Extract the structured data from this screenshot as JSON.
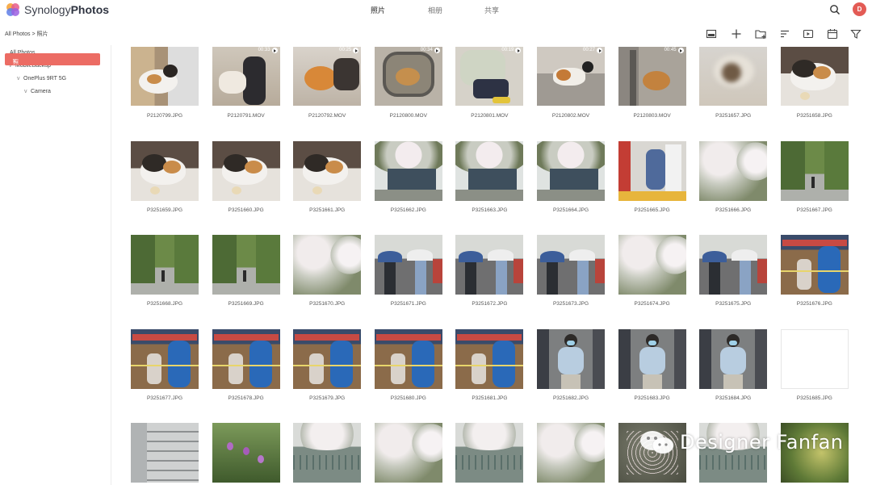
{
  "app": {
    "brand_prefix": "Synology",
    "brand_name": "Photos",
    "avatar_letter": "D",
    "accent_color": "#ec6c64"
  },
  "nav_tabs": [
    {
      "label": "照片",
      "active": true
    },
    {
      "label": "相册",
      "active": false
    },
    {
      "label": "共享",
      "active": false
    }
  ],
  "breadcrumb": {
    "root": "All Photos",
    "separator": ">",
    "current": "照片"
  },
  "toolbar": {
    "icons": [
      "select-icon",
      "add-icon",
      "new-folder-icon",
      "sort-icon",
      "slideshow-icon",
      "calendar-icon",
      "filter-icon"
    ]
  },
  "sidebar": {
    "items": [
      {
        "label": "All Photos",
        "depth": 0,
        "chevron": ""
      },
      {
        "label": "MobileBackup",
        "depth": 1,
        "chevron": "v"
      },
      {
        "label": "OnePlus 9RT 5G",
        "depth": 2,
        "chevron": "v"
      },
      {
        "label": "Camera",
        "depth": 3,
        "chevron": "v"
      },
      {
        "label": "照片",
        "depth": 1,
        "chevron": "v",
        "active": true
      }
    ]
  },
  "photos": [
    {
      "name": "P2120799.JPG",
      "scene": "cat-indoor"
    },
    {
      "name": "P2120791.MOV",
      "scene": "person-sofa",
      "duration": "00:33"
    },
    {
      "name": "P2120792.MOV",
      "scene": "cat-orange",
      "duration": "00:25"
    },
    {
      "name": "P2120800.MOV",
      "scene": "cat-carrier",
      "duration": "00:34"
    },
    {
      "name": "P2120801.MOV",
      "scene": "person-sit",
      "duration": "00:19"
    },
    {
      "name": "P2120802.MOV",
      "scene": "cat-walk",
      "duration": "00:27"
    },
    {
      "name": "P2120803.MOV",
      "scene": "cat-pole",
      "duration": "00:45"
    },
    {
      "name": "P3251657.JPG",
      "scene": "blur"
    },
    {
      "name": "P3251658.JPG",
      "scene": "cat-sit"
    },
    {
      "name": "P3251659.JPG",
      "scene": "cat-sit"
    },
    {
      "name": "P3251660.JPG",
      "scene": "cat-sit"
    },
    {
      "name": "P3251661.JPG",
      "scene": "cat-sit"
    },
    {
      "name": "P3251662.JPG",
      "scene": "blossom-house"
    },
    {
      "name": "P3251663.JPG",
      "scene": "blossom-house"
    },
    {
      "name": "P3251664.JPG",
      "scene": "blossom-house"
    },
    {
      "name": "P3251665.JPG",
      "scene": "person-blue"
    },
    {
      "name": "P3251666.JPG",
      "scene": "blossom"
    },
    {
      "name": "P3251667.JPG",
      "scene": "park"
    },
    {
      "name": "P3251668.JPG",
      "scene": "park"
    },
    {
      "name": "P3251669.JPG",
      "scene": "park"
    },
    {
      "name": "P3251670.JPG",
      "scene": "blossom"
    },
    {
      "name": "P3251671.JPG",
      "scene": "umbrella"
    },
    {
      "name": "P3251672.JPG",
      "scene": "umbrella"
    },
    {
      "name": "P3251673.JPG",
      "scene": "umbrella"
    },
    {
      "name": "P3251674.JPG",
      "scene": "blossom"
    },
    {
      "name": "P3251675.JPG",
      "scene": "umbrella"
    },
    {
      "name": "P3251676.JPG",
      "scene": "workers"
    },
    {
      "name": "P3251677.JPG",
      "scene": "workers"
    },
    {
      "name": "P3251678.JPG",
      "scene": "workers"
    },
    {
      "name": "P3251679.JPG",
      "scene": "workers"
    },
    {
      "name": "P3251680.JPG",
      "scene": "workers"
    },
    {
      "name": "P3251681.JPG",
      "scene": "workers"
    },
    {
      "name": "P3251682.JPG",
      "scene": "woman-mask"
    },
    {
      "name": "P3251683.JPG",
      "scene": "woman-mask"
    },
    {
      "name": "P3251684.JPG",
      "scene": "woman-mask"
    },
    {
      "name": "P3251685.JPG",
      "scene": "empty"
    },
    {
      "name": "",
      "scene": "building"
    },
    {
      "name": "",
      "scene": "flowers"
    },
    {
      "name": "",
      "scene": "railing"
    },
    {
      "name": "",
      "scene": "blossom"
    },
    {
      "name": "",
      "scene": "railing"
    },
    {
      "name": "",
      "scene": "blossom"
    },
    {
      "name": "",
      "scene": "petals"
    },
    {
      "name": "",
      "scene": "railing"
    },
    {
      "name": "",
      "scene": "green-blur"
    }
  ],
  "watermark": {
    "text": "Designer Fanfan",
    "icon": "wechat-icon"
  }
}
